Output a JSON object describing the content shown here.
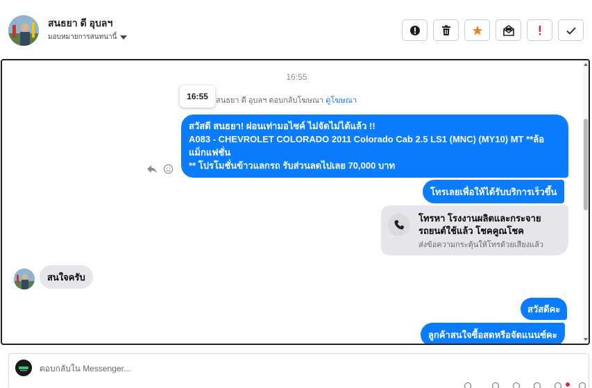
{
  "header": {
    "contact_name": "สนธยา ดี อุบลฯ",
    "assign_label": "มอบหมายการสนทนานี้",
    "actions": [
      {
        "name": "mark-spam-button",
        "icon": "exclamation-circle-icon"
      },
      {
        "name": "delete-button",
        "icon": "trash-icon"
      },
      {
        "name": "star-button",
        "icon": "star-icon",
        "color": "#e67e22"
      },
      {
        "name": "mark-unread-button",
        "icon": "envelope-icon"
      },
      {
        "name": "follow-up-button",
        "icon": "exclamation-icon",
        "color": "#e41e3f"
      },
      {
        "name": "mark-done-button",
        "icon": "checkmark-icon"
      }
    ]
  },
  "thread": {
    "timestamp": "16:55",
    "tooltip_time": "16:55",
    "reply_note": "สนธยา ดี อุบลฯ ตอบกลับโฆษณา",
    "reply_note_link": "ดูโฆษณา",
    "messages": {
      "ad_message": {
        "line1": "สวัสดี สนธยา! ผ่อนเท่ามอไซค์ ไม่จัดไม่ได้แล้ว !!",
        "line2": "A083 - CHEVROLET COLORADO 2011 Colorado Cab 2.5 LS1 (MNC) (MY10) MT **ล้อ",
        "line3": "แม็กแฟชั่น",
        "line4": "** โปรโมชั่นข้าวแลกรถ รับส่วนลดไปเลย 70,000 บาท"
      },
      "call_prompt": "โทรเลยเพื่อให้ได้รับบริการเร็วขึ้น",
      "call_card": {
        "title": "โทรหา โรงงานผลิตและกระจายรถยนต์ใช้แล้ว โชคคูณโชค",
        "subtitle": "ส่งข้อความกระตุ้นให้โทรด้วยเสียงแล้ว"
      },
      "customer_reply": "สนใจครับ",
      "greeting": "สวัสดีคะ",
      "question": "ลูกค้าสนใจซื้อสดหรือจัดแนนซ์คะ"
    }
  },
  "composer": {
    "placeholder": "ตอบกลับใน Messenger..."
  },
  "colors": {
    "outgoing_bubble": "#0a7cff",
    "incoming_bubble": "#e4e6eb",
    "link": "#1877f2"
  }
}
